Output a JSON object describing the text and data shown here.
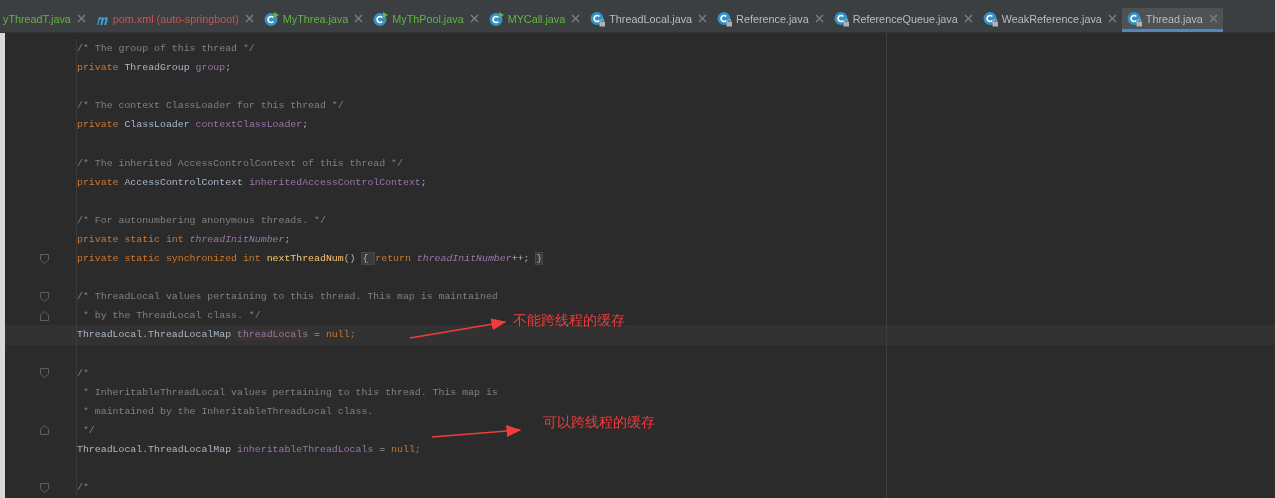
{
  "tabs": [
    {
      "label": "yThreadT.java",
      "kind": "cut",
      "color": "#62b543",
      "selected": false
    },
    {
      "label": "pom.xml (auto-springboot)",
      "kind": "maven",
      "color": "#c75450",
      "selected": false
    },
    {
      "label": "MyThrea.java",
      "kind": "class-run",
      "color": "#62b543",
      "selected": false
    },
    {
      "label": "MyThPool.java",
      "kind": "class-run",
      "color": "#62b543",
      "selected": false
    },
    {
      "label": "MYCall.java",
      "kind": "class-run",
      "color": "#62b543",
      "selected": false
    },
    {
      "label": "ThreadLocal.java",
      "kind": "class-locked",
      "color": "#bbbbbb",
      "selected": false
    },
    {
      "label": "Reference.java",
      "kind": "class-locked",
      "color": "#bbbbbb",
      "selected": false
    },
    {
      "label": "ReferenceQueue.java",
      "kind": "class-locked",
      "color": "#bbbbbb",
      "selected": false
    },
    {
      "label": "WeakReference.java",
      "kind": "class-locked",
      "color": "#bbbbbb",
      "selected": false
    },
    {
      "label": "Thread.java",
      "kind": "class-locked",
      "color": "#bbbbbb",
      "selected": true
    }
  ],
  "code_lines": [
    {
      "kind": "code",
      "tokens": [
        {
          "kind": "comment",
          "text": "/* The group of this thread */"
        }
      ]
    },
    {
      "kind": "code",
      "tokens": [
        {
          "kind": "keyword",
          "text": "private "
        },
        {
          "kind": "plain",
          "text": "ThreadGroup "
        },
        {
          "kind": "field",
          "text": "group"
        },
        {
          "kind": "plain",
          "text": ";"
        }
      ]
    },
    {
      "kind": "blank"
    },
    {
      "kind": "code",
      "tokens": [
        {
          "kind": "comment",
          "text": "/* The context ClassLoader for this thread */"
        }
      ]
    },
    {
      "kind": "code",
      "tokens": [
        {
          "kind": "keyword",
          "text": "private "
        },
        {
          "kind": "plain",
          "text": "ClassLoader "
        },
        {
          "kind": "field",
          "text": "contextClassLoader"
        },
        {
          "kind": "plain",
          "text": ";"
        }
      ]
    },
    {
      "kind": "blank"
    },
    {
      "kind": "code",
      "tokens": [
        {
          "kind": "comment",
          "text": "/* The inherited AccessControlContext of this thread */"
        }
      ]
    },
    {
      "kind": "code",
      "tokens": [
        {
          "kind": "keyword",
          "text": "private "
        },
        {
          "kind": "plain",
          "text": "AccessControlContext "
        },
        {
          "kind": "field",
          "text": "inheritedAccessControlContext"
        },
        {
          "kind": "plain",
          "text": ";"
        }
      ]
    },
    {
      "kind": "blank"
    },
    {
      "kind": "code",
      "tokens": [
        {
          "kind": "comment",
          "text": "/* For autonumbering anonymous threads. */"
        }
      ]
    },
    {
      "kind": "code",
      "tokens": [
        {
          "kind": "keyword",
          "text": "private static int "
        },
        {
          "kind": "static",
          "text": "threadInitNumber"
        },
        {
          "kind": "plain",
          "text": ";"
        }
      ]
    },
    {
      "kind": "fold-start",
      "tokens": [
        {
          "kind": "keyword",
          "text": "private static synchronized int "
        },
        {
          "kind": "method",
          "text": "nextThreadNum"
        },
        {
          "kind": "plain",
          "text": "() "
        },
        {
          "kind": "folded",
          "text": "{ "
        },
        {
          "kind": "keyword",
          "text": "return "
        },
        {
          "kind": "static",
          "text": "threadInitNumber"
        },
        {
          "kind": "plain",
          "text": "++; "
        },
        {
          "kind": "folded",
          "text": "}"
        }
      ]
    },
    {
      "kind": "blank"
    },
    {
      "kind": "fold-start",
      "tokens": [
        {
          "kind": "comment",
          "text": "/* ThreadLocal values pertaining to this thread. This map is maintained"
        }
      ]
    },
    {
      "kind": "fold-end",
      "tokens": [
        {
          "kind": "comment",
          "text": " * by the ThreadLocal class. */"
        }
      ]
    },
    {
      "kind": "code",
      "current": true,
      "tokens": [
        {
          "kind": "plain",
          "text": "ThreadLocal.ThreadLocalMap "
        },
        {
          "kind": "field-hl",
          "text": "threadLocals"
        },
        {
          "kind": "plain",
          "text": " = "
        },
        {
          "kind": "keyword",
          "text": "null;"
        }
      ]
    },
    {
      "kind": "blank"
    },
    {
      "kind": "fold-start",
      "tokens": [
        {
          "kind": "comment",
          "text": "/*"
        }
      ]
    },
    {
      "kind": "code",
      "tokens": [
        {
          "kind": "comment",
          "text": " * InheritableThreadLocal values pertaining to this thread. This map is"
        }
      ]
    },
    {
      "kind": "code",
      "tokens": [
        {
          "kind": "comment",
          "text": " * maintained by the InheritableThreadLocal class."
        }
      ]
    },
    {
      "kind": "fold-end",
      "tokens": [
        {
          "kind": "comment",
          "text": " */"
        }
      ]
    },
    {
      "kind": "code",
      "tokens": [
        {
          "kind": "plain",
          "text": "ThreadLocal.ThreadLocalMap "
        },
        {
          "kind": "field",
          "text": "inheritableThreadLocals"
        },
        {
          "kind": "plain",
          "text": " = "
        },
        {
          "kind": "keyword",
          "text": "null;"
        }
      ]
    },
    {
      "kind": "blank"
    },
    {
      "kind": "fold-start",
      "tokens": [
        {
          "kind": "comment",
          "text": "/*"
        }
      ]
    }
  ],
  "annotations": [
    {
      "text": "不能跨线程的缓存"
    },
    {
      "text": "可以跨线程的缓存"
    }
  ]
}
